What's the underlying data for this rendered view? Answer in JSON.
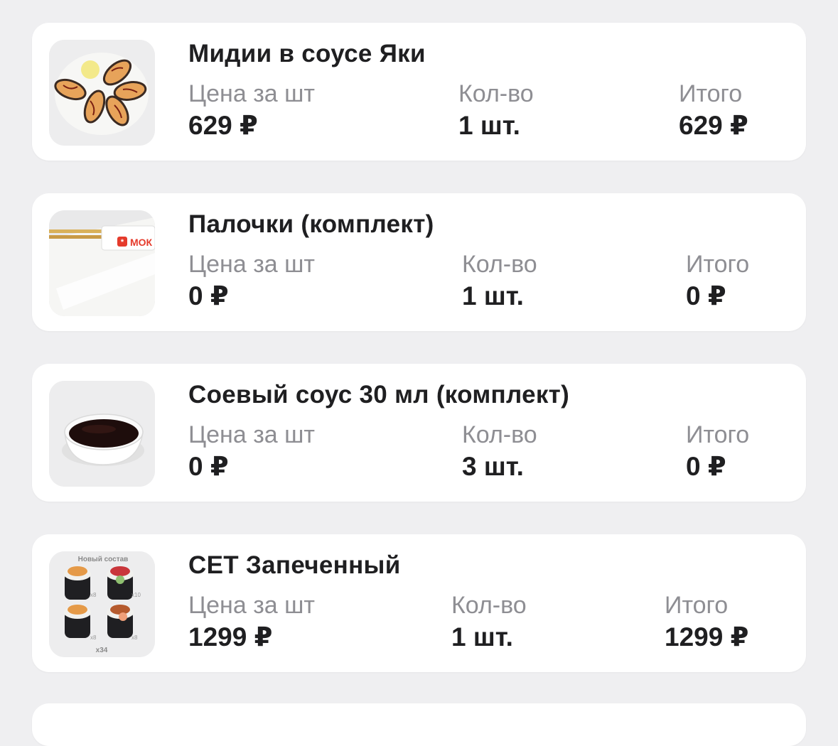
{
  "order_items": [
    {
      "name": "Мидии в соусе Яки",
      "price_label": "Цена за шт",
      "price": "629 ₽",
      "qty_label": "Кол-во",
      "qty": "1 шт.",
      "total_label": "Итого",
      "total": "629 ₽",
      "image_icon": "mussels-image-icon"
    },
    {
      "name": "Палочки (комплект)",
      "price_label": "Цена за шт",
      "price": "0 ₽",
      "qty_label": "Кол-во",
      "qty": "1 шт.",
      "total_label": "Итого",
      "total": "0 ₽",
      "image_icon": "chopsticks-image-icon",
      "image_text": "МОК"
    },
    {
      "name": "Соевый соус 30 мл (комплект)",
      "price_label": "Цена за шт",
      "price": "0 ₽",
      "qty_label": "Кол-во",
      "qty": "3 шт.",
      "total_label": "Итого",
      "total": "0 ₽",
      "image_icon": "soy-sauce-image-icon"
    },
    {
      "name": "СЕТ Запеченный",
      "price_label": "Цена за шт",
      "price": "1299 ₽",
      "qty_label": "Кол-во",
      "qty": "1 шт.",
      "total_label": "Итого",
      "total": "1299 ₽",
      "image_icon": "sushi-set-image-icon",
      "image_text": {
        "badge": "Новый состав",
        "count": "x34",
        "portions": [
          "x8",
          "x10",
          "x8",
          "x8"
        ]
      }
    }
  ],
  "colors": {
    "background": "#efeff1",
    "card": "#ffffff",
    "text_primary": "#1f1f21",
    "text_secondary": "#8e8e93",
    "accent": "#e53b2c"
  }
}
